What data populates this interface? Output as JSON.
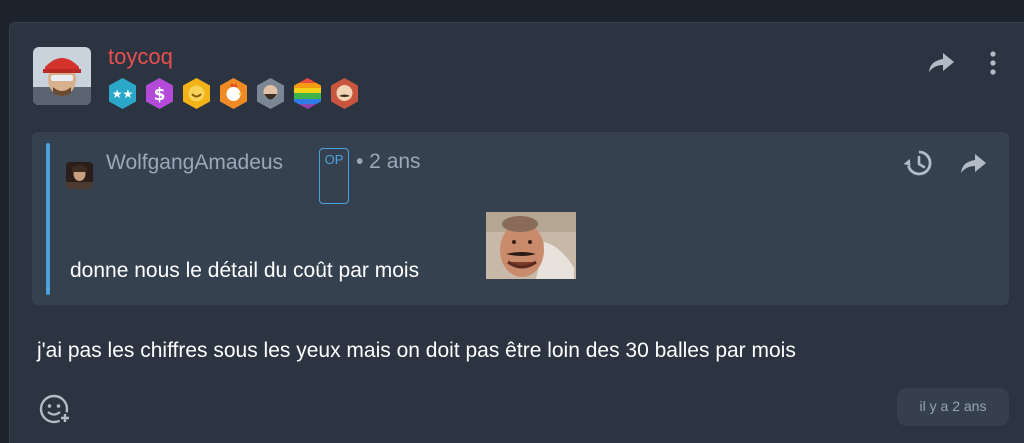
{
  "post": {
    "author": "toycoq",
    "badges": [
      {
        "icon": "stars-badge-icon",
        "color": "#2aa7c9"
      },
      {
        "icon": "dollar-badge-icon",
        "color": "#b44bd8"
      },
      {
        "icon": "smile-badge-icon",
        "color": "#f2b318"
      },
      {
        "icon": "rooster-badge-icon",
        "color": "#f08a24"
      },
      {
        "icon": "bearded-face-badge-icon",
        "color": "#7b8794"
      },
      {
        "icon": "rainbow-badge-icon",
        "color": "#e94b3c"
      },
      {
        "icon": "mustache-face-badge-icon",
        "color": "#c8553d"
      }
    ],
    "message": "j'ai pas les chiffres sous les yeux mais on doit pas être loin des 30 balles par mois",
    "timestamp": "il y a 2 ans"
  },
  "quote": {
    "author": "WolfgangAmadeus",
    "op_label": "OP",
    "time": "• 2 ans",
    "text": "donne nous le détail du coût par mois"
  },
  "colors": {
    "background": "#1c232c",
    "card": "#2b3440",
    "quote_bg": "#364150",
    "accent": "#4aa3df",
    "username": "#ea4f4f"
  }
}
